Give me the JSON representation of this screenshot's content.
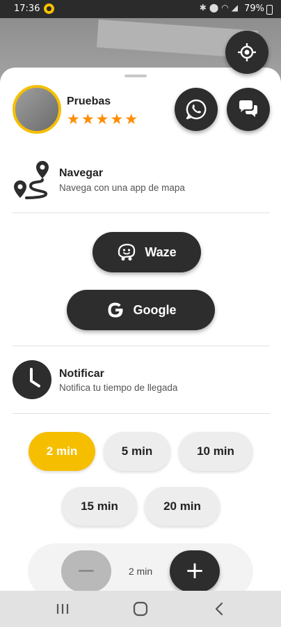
{
  "status_bar": {
    "time": "17:36",
    "battery": "79%",
    "icons": [
      "bluetooth-icon",
      "location-icon",
      "wifi-icon",
      "signal-icon"
    ]
  },
  "driver": {
    "name": "Pruebas",
    "stars": "★★★★★",
    "rating": 5,
    "max_rating": 5
  },
  "navigate": {
    "title": "Navegar",
    "subtitle": "Navega con una app de mapa",
    "waze_label": "Waze",
    "google_label": "Google"
  },
  "notify": {
    "title": "Notificar",
    "subtitle": "Notifica tu tiempo de llegada",
    "options": [
      "2 min",
      "5 min",
      "10 min",
      "15 min",
      "20 min"
    ],
    "selected": "2 min"
  },
  "stepper": {
    "value": "2 min",
    "minus": "−",
    "plus": "+"
  },
  "colors": {
    "accent": "#f5bf00",
    "dark": "#2d2d2d",
    "star": "#ff8c00"
  }
}
